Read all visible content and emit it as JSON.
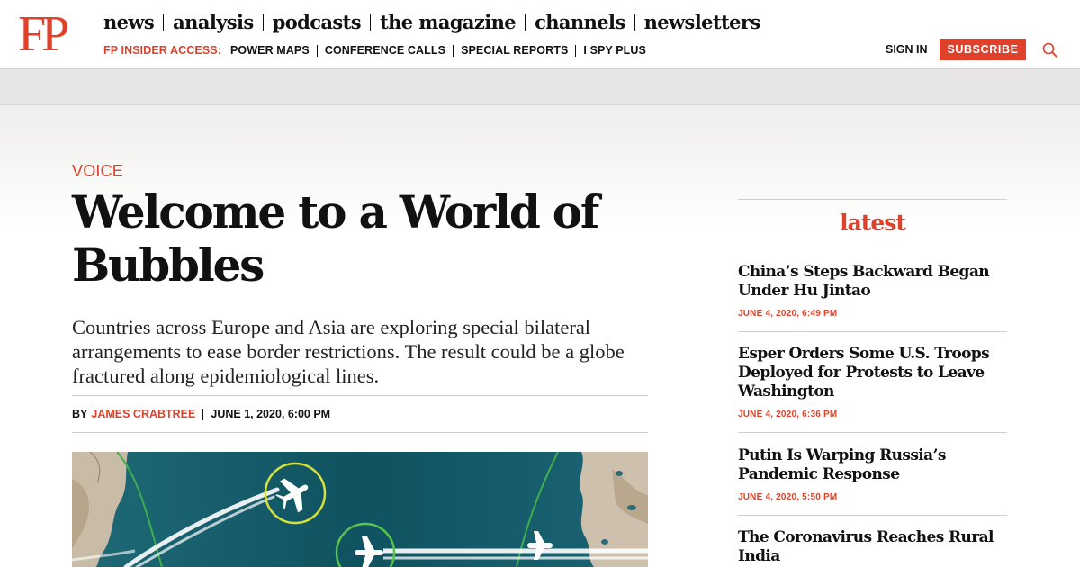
{
  "brand": {
    "logo_text": "FP",
    "accent_color": "#e0412b"
  },
  "nav": {
    "main": [
      "news",
      "analysis",
      "podcasts",
      "the magazine",
      "channels",
      "newsletters"
    ],
    "insider_label": "FP INSIDER ACCESS:",
    "insider_links": [
      "POWER MAPS",
      "CONFERENCE CALLS",
      "SPECIAL REPORTS",
      "I SPY PLUS"
    ],
    "signin": "SIGN IN",
    "subscribe": "SUBSCRIBE",
    "search_icon": "search-icon"
  },
  "article": {
    "kicker": "VOICE",
    "headline_line1": "Welcome to a World of",
    "headline_line2": "Bubbles",
    "dek": "Countries across Europe and Asia are exploring special bilateral arrangements to ease border restrictions. The result could be a globe fractured along epidemiological lines.",
    "byline_prefix": "BY",
    "author": "JAMES CRABTREE",
    "date": "JUNE 1, 2020, 6:00 PM"
  },
  "latest": {
    "title": "latest",
    "items": [
      {
        "title": "China’s Steps Backward Began Under Hu Jintao",
        "date": "JUNE 4, 2020, 6:49 PM"
      },
      {
        "title": "Esper Orders Some U.S. Troops Deployed for Protests to Leave Washington",
        "date": "JUNE 4, 2020, 6:36 PM"
      },
      {
        "title": "Putin Is Warping Russia’s Pandemic Response",
        "date": "JUNE 4, 2020, 5:50 PM"
      },
      {
        "title": "The Coronavirus Reaches Rural India",
        "date": ""
      }
    ]
  }
}
